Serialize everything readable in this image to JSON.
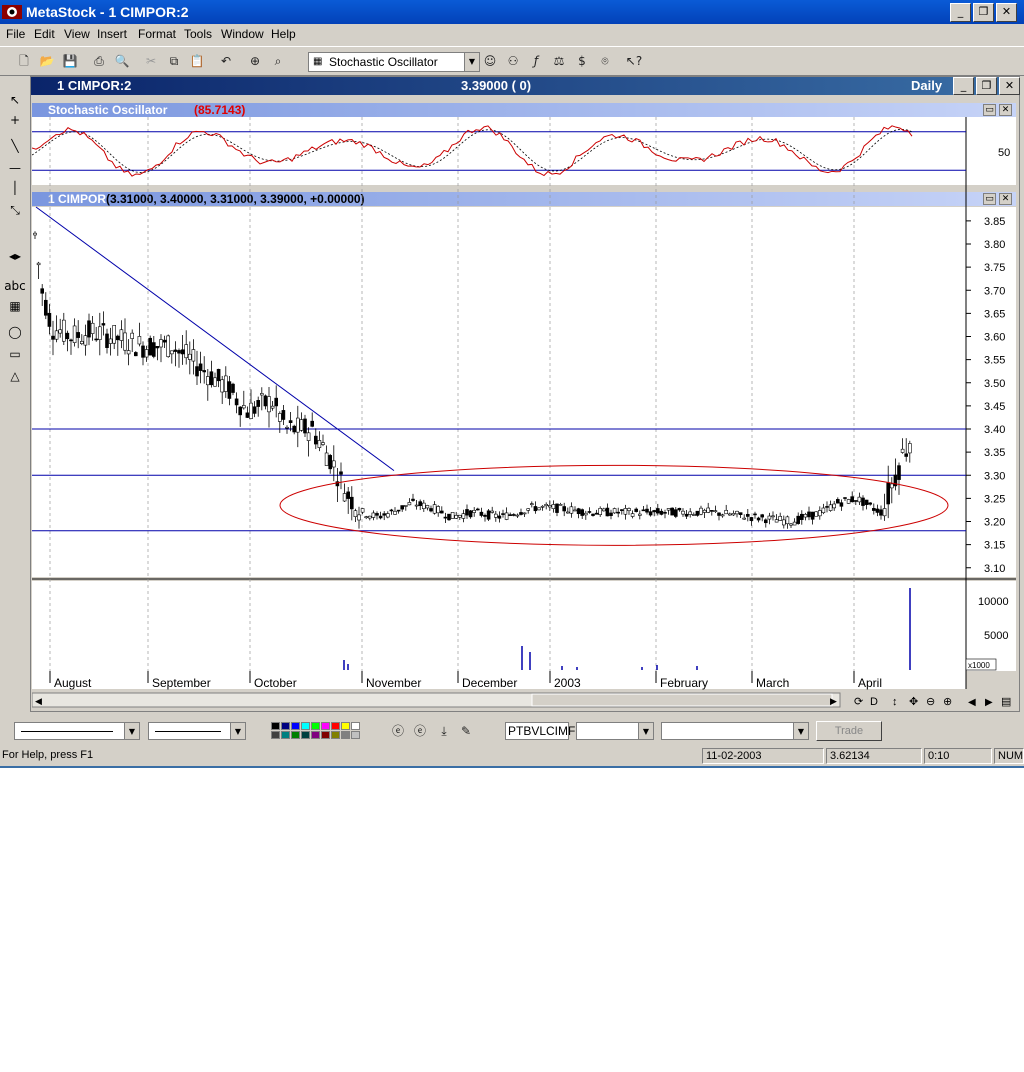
{
  "app": {
    "title": "MetaStock - 1 CIMPOR:2",
    "menu": [
      "File",
      "Edit",
      "View",
      "Insert",
      "Format",
      "Tools",
      "Window",
      "Help"
    ],
    "indicator_select": "Stochastic Oscillator"
  },
  "chart_window": {
    "title": "1 CIMPOR:2",
    "price": "3.39000 ( 0)",
    "periodicity": "Daily",
    "stochastic_title": "Stochastic Oscillator",
    "stochastic_value": "(85.7143)",
    "price_title": "1 CIMPOR",
    "price_values": "(3.31000, 3.40000, 3.31000, 3.39000, +0.00000)",
    "volume_unit": "x1000"
  },
  "chart_data": {
    "type": "candlestick",
    "x_ticks": [
      "August",
      "September",
      "October",
      "November",
      "December",
      "2003",
      "February",
      "March",
      "April"
    ],
    "price_ticks": [
      "3.85",
      "3.80",
      "3.75",
      "3.70",
      "3.65",
      "3.60",
      "3.55",
      "3.50",
      "3.45",
      "3.40",
      "3.35",
      "3.30",
      "3.25",
      "3.20",
      "3.15",
      "3.10"
    ],
    "ylim": [
      3.08,
      3.88
    ],
    "stochastic_ticks": [
      "50"
    ],
    "stochastic_levels": [
      80,
      20
    ],
    "volume_ticks": [
      "10000",
      "5000"
    ],
    "horizontal_lines": [
      3.4,
      3.3,
      3.18
    ],
    "colors": {
      "k_line": "#cc0000",
      "d_line": "#000000",
      "lines": "#0000aa",
      "ellipse": "#cc0000"
    }
  },
  "bottom_toolbar": {
    "symbol_field": "PTBVLCIMF",
    "trade_label": "Trade"
  },
  "statusbar": {
    "help": "For Help, press F1",
    "date": "11-02-2003",
    "value": "3.62134",
    "time": "0:10",
    "num": "NUM"
  }
}
